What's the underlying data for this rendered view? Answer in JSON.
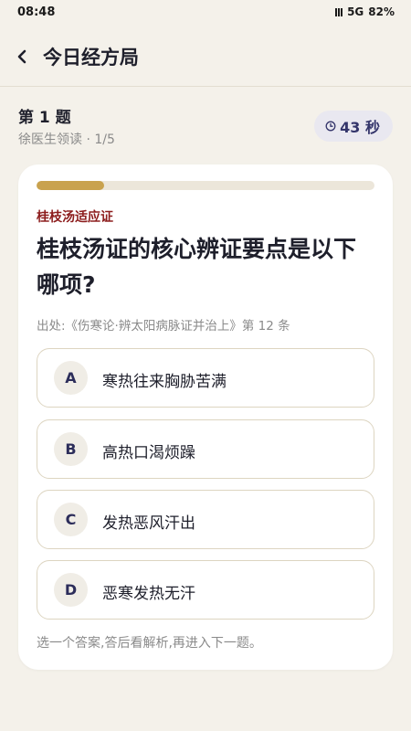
{
  "status_bar": {
    "time": "08:48",
    "network": "5G",
    "battery": "82%",
    "signal_icon": "signal-bars-icon"
  },
  "header": {
    "title": "今日经方局",
    "back_icon": "chevron-left-icon"
  },
  "question_meta": {
    "heading": "第 1 题",
    "subtitle": "徐医生领读 · 1/5",
    "timer": "43 秒",
    "timer_icon": "clock-icon"
  },
  "card": {
    "progress": 0.2,
    "progress_color": "#c9a24e",
    "category": "桂枝汤适应证",
    "category_color": "#8c1c1c",
    "question": "桂枝汤证的核心辨证要点是以下哪项?",
    "source": "出处:《伤寒论·辨太阳病脉证并治上》第 12 条",
    "options": [
      {
        "letter": "A",
        "text": "寒热往来胸胁苦满"
      },
      {
        "letter": "B",
        "text": "高热口渴烦躁"
      },
      {
        "letter": "C",
        "text": "发热恶风汗出"
      },
      {
        "letter": "D",
        "text": "恶寒发热无汗"
      }
    ],
    "hint": "选一个答案,答后看解析,再进入下一题。"
  }
}
